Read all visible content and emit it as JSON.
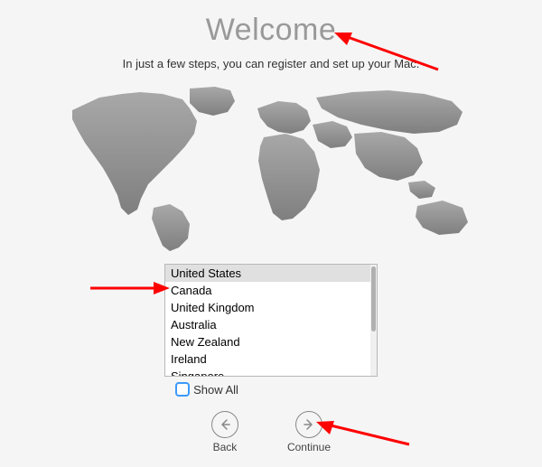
{
  "header": {
    "title": "Welcome",
    "subtitle": "In just a few steps, you can register and set up your Mac."
  },
  "countries": {
    "items": [
      {
        "label": "United States",
        "selected": true
      },
      {
        "label": "Canada",
        "selected": false
      },
      {
        "label": "United Kingdom",
        "selected": false
      },
      {
        "label": "Australia",
        "selected": false
      },
      {
        "label": "New Zealand",
        "selected": false
      },
      {
        "label": "Ireland",
        "selected": false
      },
      {
        "label": "Singapore",
        "selected": false
      }
    ]
  },
  "showall": {
    "label": "Show All",
    "checked": false
  },
  "nav": {
    "back": "Back",
    "continue": "Continue"
  }
}
